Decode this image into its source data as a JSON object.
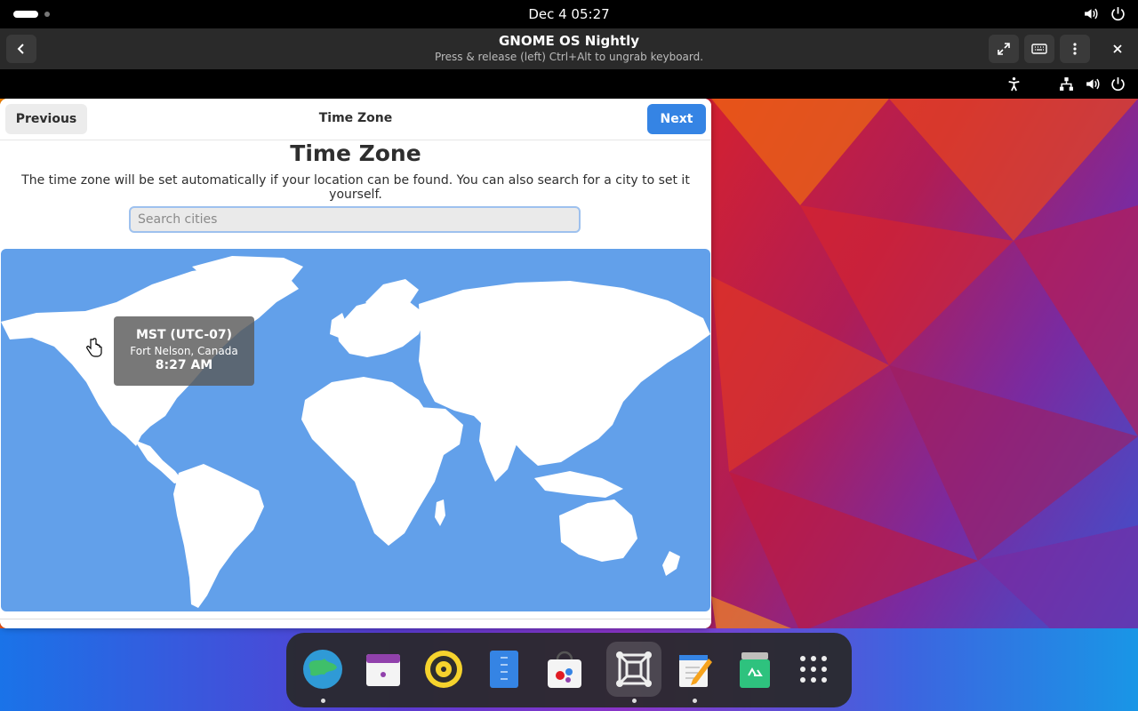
{
  "host": {
    "clock": "Dec 4  05:27"
  },
  "vm": {
    "title": "GNOME OS Nightly",
    "subtitle": "Press & release (left) Ctrl+Alt to ungrab keyboard."
  },
  "setup": {
    "previous_label": "Previous",
    "next_label": "Next",
    "header_title": "Time Zone",
    "page_title": "Time Zone",
    "description": "The time zone will be set automatically if your location can be found. You can also search for a city to set it yourself.",
    "search_placeholder": "Search cities"
  },
  "tooltip": {
    "zone": "MST (UTC-07)",
    "city": "Fort Nelson, Canada",
    "time": "8:27 AM"
  },
  "dock": {
    "apps": [
      "web-browser",
      "calendar",
      "music-player",
      "text-document-viewer",
      "software-store",
      "boxes",
      "text-editor",
      "trash-can"
    ],
    "grid": "show-apps"
  },
  "colors": {
    "accent": "#3584e4",
    "map_water": "#62a0ea"
  }
}
